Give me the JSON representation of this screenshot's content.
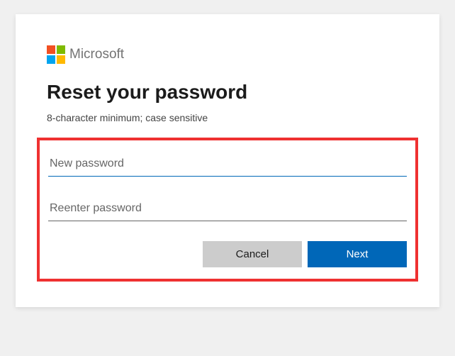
{
  "brand": {
    "name": "Microsoft"
  },
  "header": {
    "title": "Reset your password",
    "hint": "8-character minimum; case sensitive"
  },
  "form": {
    "newPassword": {
      "placeholder": "New password",
      "value": ""
    },
    "reenterPassword": {
      "placeholder": "Reenter password",
      "value": ""
    }
  },
  "buttons": {
    "cancel": "Cancel",
    "next": "Next"
  },
  "colors": {
    "primary": "#0067b8",
    "secondary": "#cccccc",
    "highlight_border": "#ef3131"
  }
}
